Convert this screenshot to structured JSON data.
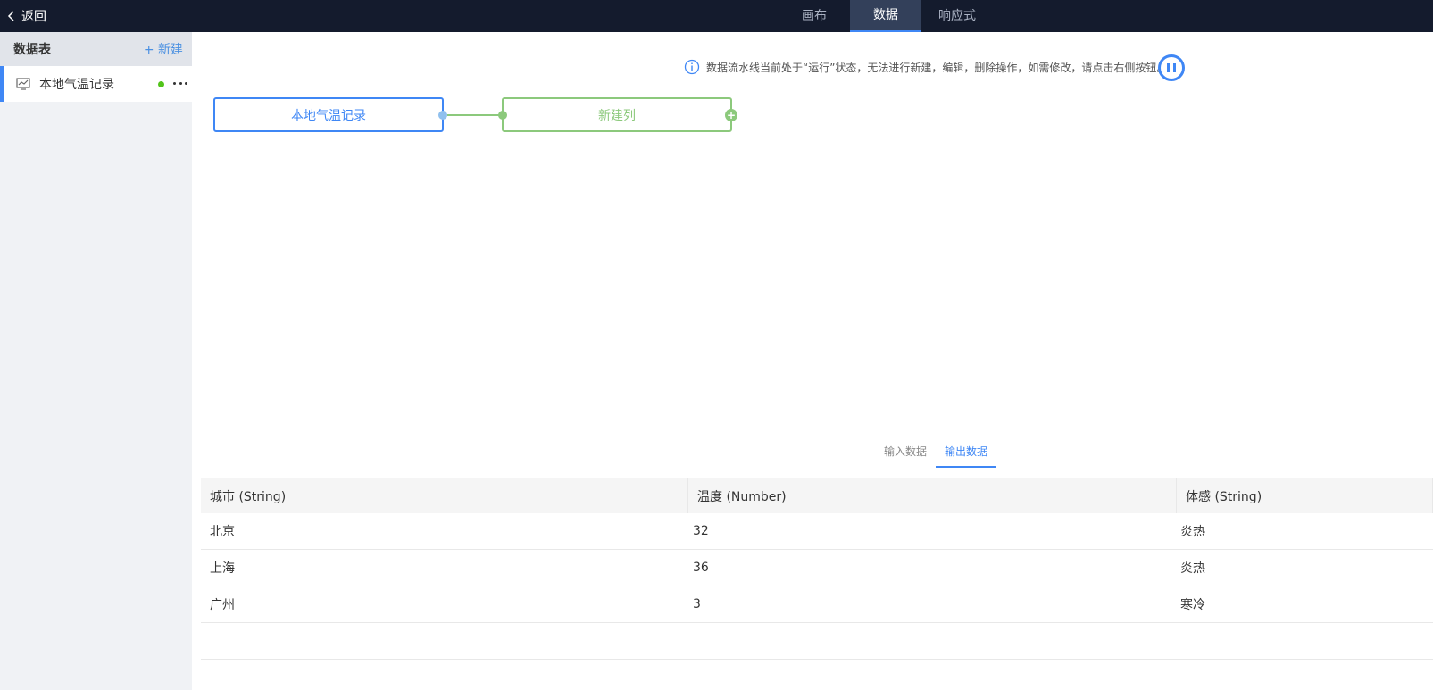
{
  "topbar": {
    "back_label": "返回",
    "tabs": [
      {
        "label": "画布",
        "active": false
      },
      {
        "label": "数据",
        "active": true
      },
      {
        "label": "响应式",
        "active": false
      }
    ]
  },
  "sidebar": {
    "title": "数据表",
    "new_label": "+ 新建",
    "items": [
      {
        "label": "本地气温记录",
        "status": "running",
        "status_color": "#52c41a",
        "icon": "chart-icon"
      }
    ]
  },
  "notice": {
    "text": "数据流水线当前处于“运行”状态，无法进行新建，编辑，删除操作，如需修改，请点击右侧按钮。",
    "icon": "info-icon",
    "action_icon": "pause-icon"
  },
  "pipeline": {
    "nodes": [
      {
        "label": "本地气温记录",
        "color": "#3f87f5"
      },
      {
        "label": "新建列",
        "color": "#8cc97c"
      }
    ]
  },
  "data_tabs": [
    {
      "label": "输入数据",
      "active": false
    },
    {
      "label": "输出数据",
      "active": true
    }
  ],
  "table": {
    "columns": [
      "城市 (String)",
      "温度 (Number)",
      "体感 (String)"
    ],
    "rows": [
      [
        "北京",
        "32",
        "炎热"
      ],
      [
        "上海",
        "36",
        "炎热"
      ],
      [
        "广州",
        "3",
        "寒冷"
      ]
    ]
  },
  "colors": {
    "accent": "#3f87f5",
    "topbar_bg": "#141b2d",
    "node_green": "#8cc97c"
  }
}
